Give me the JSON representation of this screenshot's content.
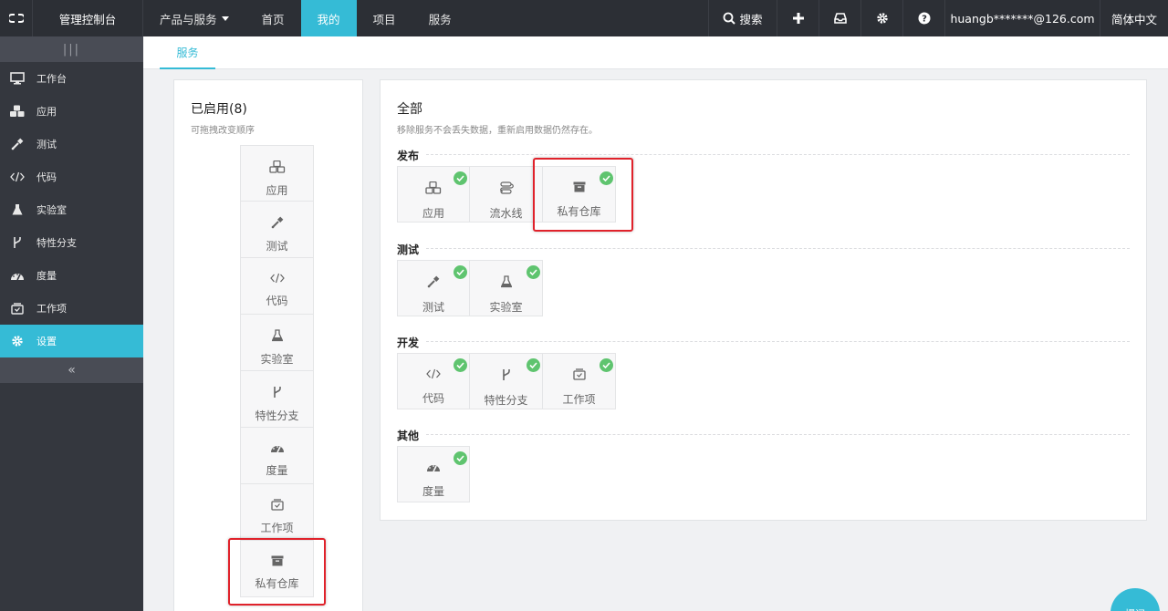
{
  "topbar": {
    "logo_icon": "link-logo-icon",
    "console_label": "管理控制台",
    "nav": [
      {
        "label": "产品与服务",
        "has_caret": true
      },
      {
        "label": "首页"
      },
      {
        "label": "我的",
        "active": true
      },
      {
        "label": "项目"
      },
      {
        "label": "服务"
      }
    ],
    "search_label": "搜索",
    "user_email": "huangb*******@126.com",
    "language": "简体中文"
  },
  "sidebar": {
    "handle": "|||",
    "items": [
      {
        "label": "工作台",
        "icon": "monitor-icon"
      },
      {
        "label": "应用",
        "icon": "cubes-icon"
      },
      {
        "label": "测试",
        "icon": "dropper-icon"
      },
      {
        "label": "代码",
        "icon": "code-icon"
      },
      {
        "label": "实验室",
        "icon": "flask-icon"
      },
      {
        "label": "特性分支",
        "icon": "branch-icon"
      },
      {
        "label": "度量",
        "icon": "gauge-icon"
      },
      {
        "label": "工作项",
        "icon": "inbox-check-icon"
      },
      {
        "label": "设置",
        "icon": "gear-icon",
        "active": true
      }
    ],
    "collapse": "«"
  },
  "tabs": [
    {
      "label": "服务",
      "active": true
    }
  ],
  "enabled": {
    "title": "已启用(8)",
    "subtitle": "可拖拽改变顺序",
    "items": [
      {
        "label": "应用",
        "icon": "cubes-icon"
      },
      {
        "label": "测试",
        "icon": "dropper-icon"
      },
      {
        "label": "代码",
        "icon": "code-icon"
      },
      {
        "label": "实验室",
        "icon": "flask-icon"
      },
      {
        "label": "特性分支",
        "icon": "branch-icon"
      },
      {
        "label": "度量",
        "icon": "gauge-icon"
      },
      {
        "label": "工作项",
        "icon": "inbox-check-icon"
      },
      {
        "label": "私有仓库",
        "icon": "archive-icon"
      }
    ]
  },
  "all": {
    "title": "全部",
    "subtitle": "移除服务不会丢失数据，重新启用数据仍然存在。",
    "groups": [
      {
        "title": "发布",
        "items": [
          {
            "label": "应用",
            "icon": "cubes-icon",
            "enabled": true
          },
          {
            "label": "流水线",
            "icon": "pipeline-icon",
            "enabled": false
          },
          {
            "label": "私有仓库",
            "icon": "archive-icon",
            "enabled": true
          }
        ]
      },
      {
        "title": "测试",
        "items": [
          {
            "label": "测试",
            "icon": "dropper-icon",
            "enabled": true
          },
          {
            "label": "实验室",
            "icon": "flask-icon",
            "enabled": true
          }
        ]
      },
      {
        "title": "开发",
        "items": [
          {
            "label": "代码",
            "icon": "code-icon",
            "enabled": true
          },
          {
            "label": "特性分支",
            "icon": "branch-icon",
            "enabled": true
          },
          {
            "label": "工作项",
            "icon": "inbox-check-icon",
            "enabled": true
          }
        ]
      },
      {
        "title": "其他",
        "items": [
          {
            "label": "度量",
            "icon": "gauge-icon",
            "enabled": true
          }
        ]
      }
    ]
  },
  "fab_label": "提问",
  "colors": {
    "accent": "#35bbd6",
    "topbar": "#2c2f35",
    "sidebar": "#34373e",
    "check": "#5fc46f",
    "highlight": "#e0222b"
  }
}
